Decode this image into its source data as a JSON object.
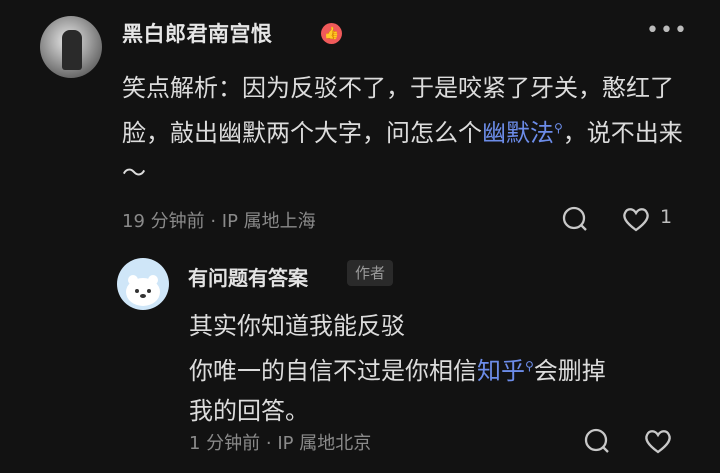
{
  "comment": {
    "username": "黑白郎君南宫恨",
    "badge_glyph": "👍",
    "more_label": "•••",
    "text_part1": "笑点解析：因为反驳不了，于是咬紧了牙关，憨红了脸，敲出幽默两个大字，问怎么个",
    "link_text": "幽默法",
    "text_part2": "，说不出来～",
    "meta": "19 分钟前 · IP 属地上海",
    "like_count": "1"
  },
  "reply": {
    "username": "有问题有答案",
    "author_tag": "作者",
    "line1": "其实你知道我能反驳",
    "line2_part1": "你唯一的自信不过是你相信",
    "link_text": "知乎",
    "line2_part2": "会删掉",
    "line3": "我的回答。",
    "meta": "1 分钟前 · IP 属地北京"
  },
  "colors": {
    "background": "#121212",
    "link": "#6c8ce8",
    "badge": "#f05a5a"
  }
}
